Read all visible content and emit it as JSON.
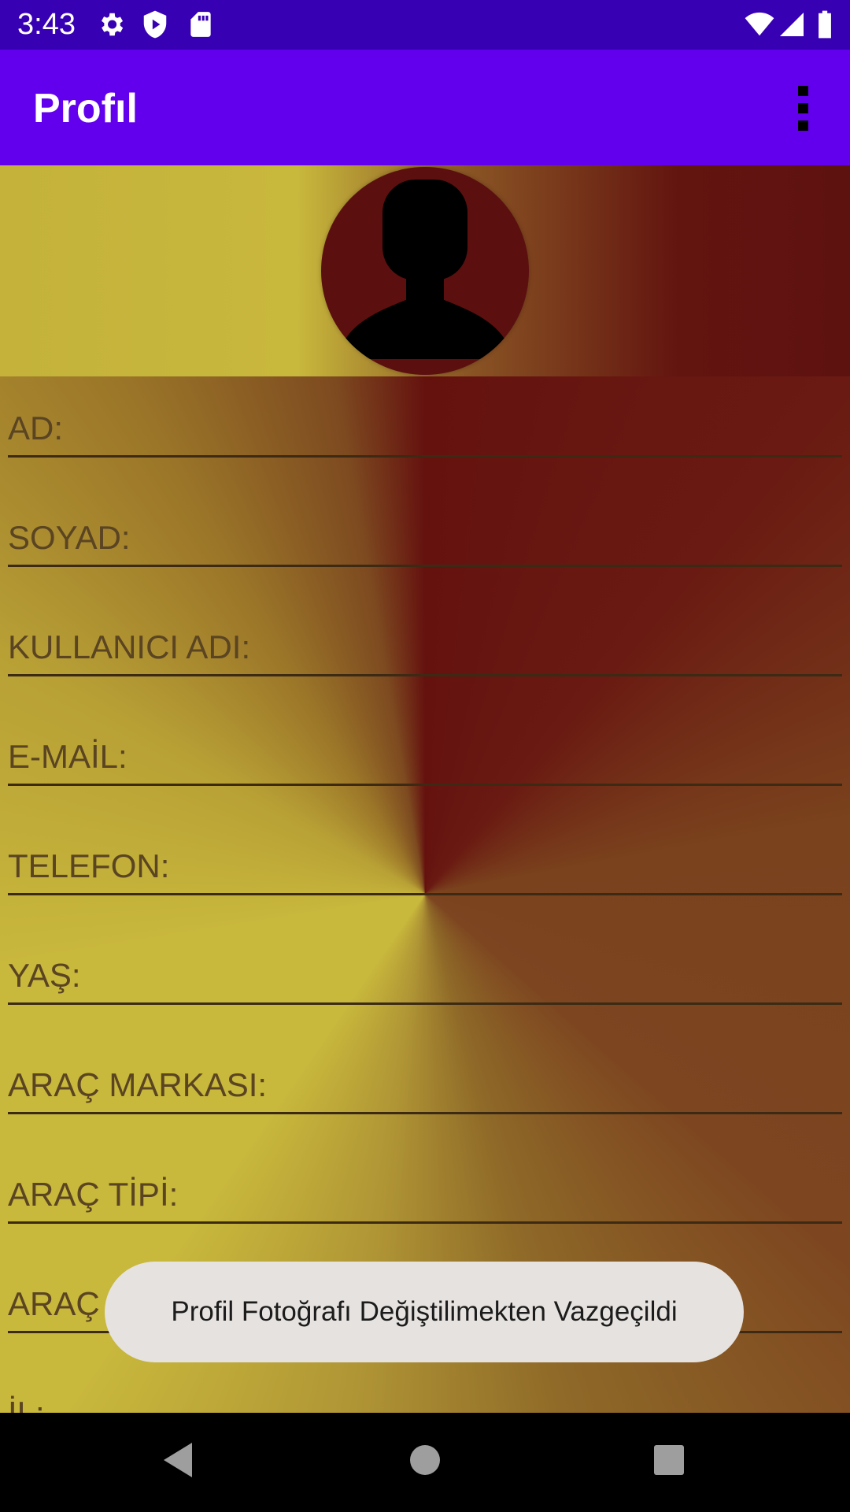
{
  "status_bar": {
    "time": "3:43",
    "icons": [
      "gear-icon",
      "shield-play-icon",
      "sd-card-icon",
      "wifi-icon",
      "signal-icon",
      "battery-icon"
    ]
  },
  "app_bar": {
    "title": "Profıl",
    "overflow_icon": "more-vert-icon"
  },
  "profile": {
    "avatar_icon": "person-silhouette-icon"
  },
  "fields": [
    {
      "label": "AD:"
    },
    {
      "label": "SOYAD:"
    },
    {
      "label": "KULLANICI ADI:"
    },
    {
      "label": "E-MAİL:"
    },
    {
      "label": "TELEFON:"
    },
    {
      "label": "YAŞ:"
    },
    {
      "label": "ARAÇ MARKASI:"
    },
    {
      "label": "ARAÇ TİPİ:"
    },
    {
      "label": "ARAÇ MODELİ:"
    },
    {
      "label": "İL:"
    }
  ],
  "toast": {
    "message": "Profil Fotoğrafı Değiştilimekten Vazgeçildi"
  },
  "nav_bar": {
    "back_icon": "back-triangle-icon",
    "home_icon": "home-circle-icon",
    "recents_icon": "recents-square-icon"
  },
  "colors": {
    "status_bar": "#3700b3",
    "app_bar": "#6200ee",
    "gradient_gold": "#c8b83c",
    "gradient_maroon": "#65120f",
    "toast_bg": "#e6e2df"
  }
}
